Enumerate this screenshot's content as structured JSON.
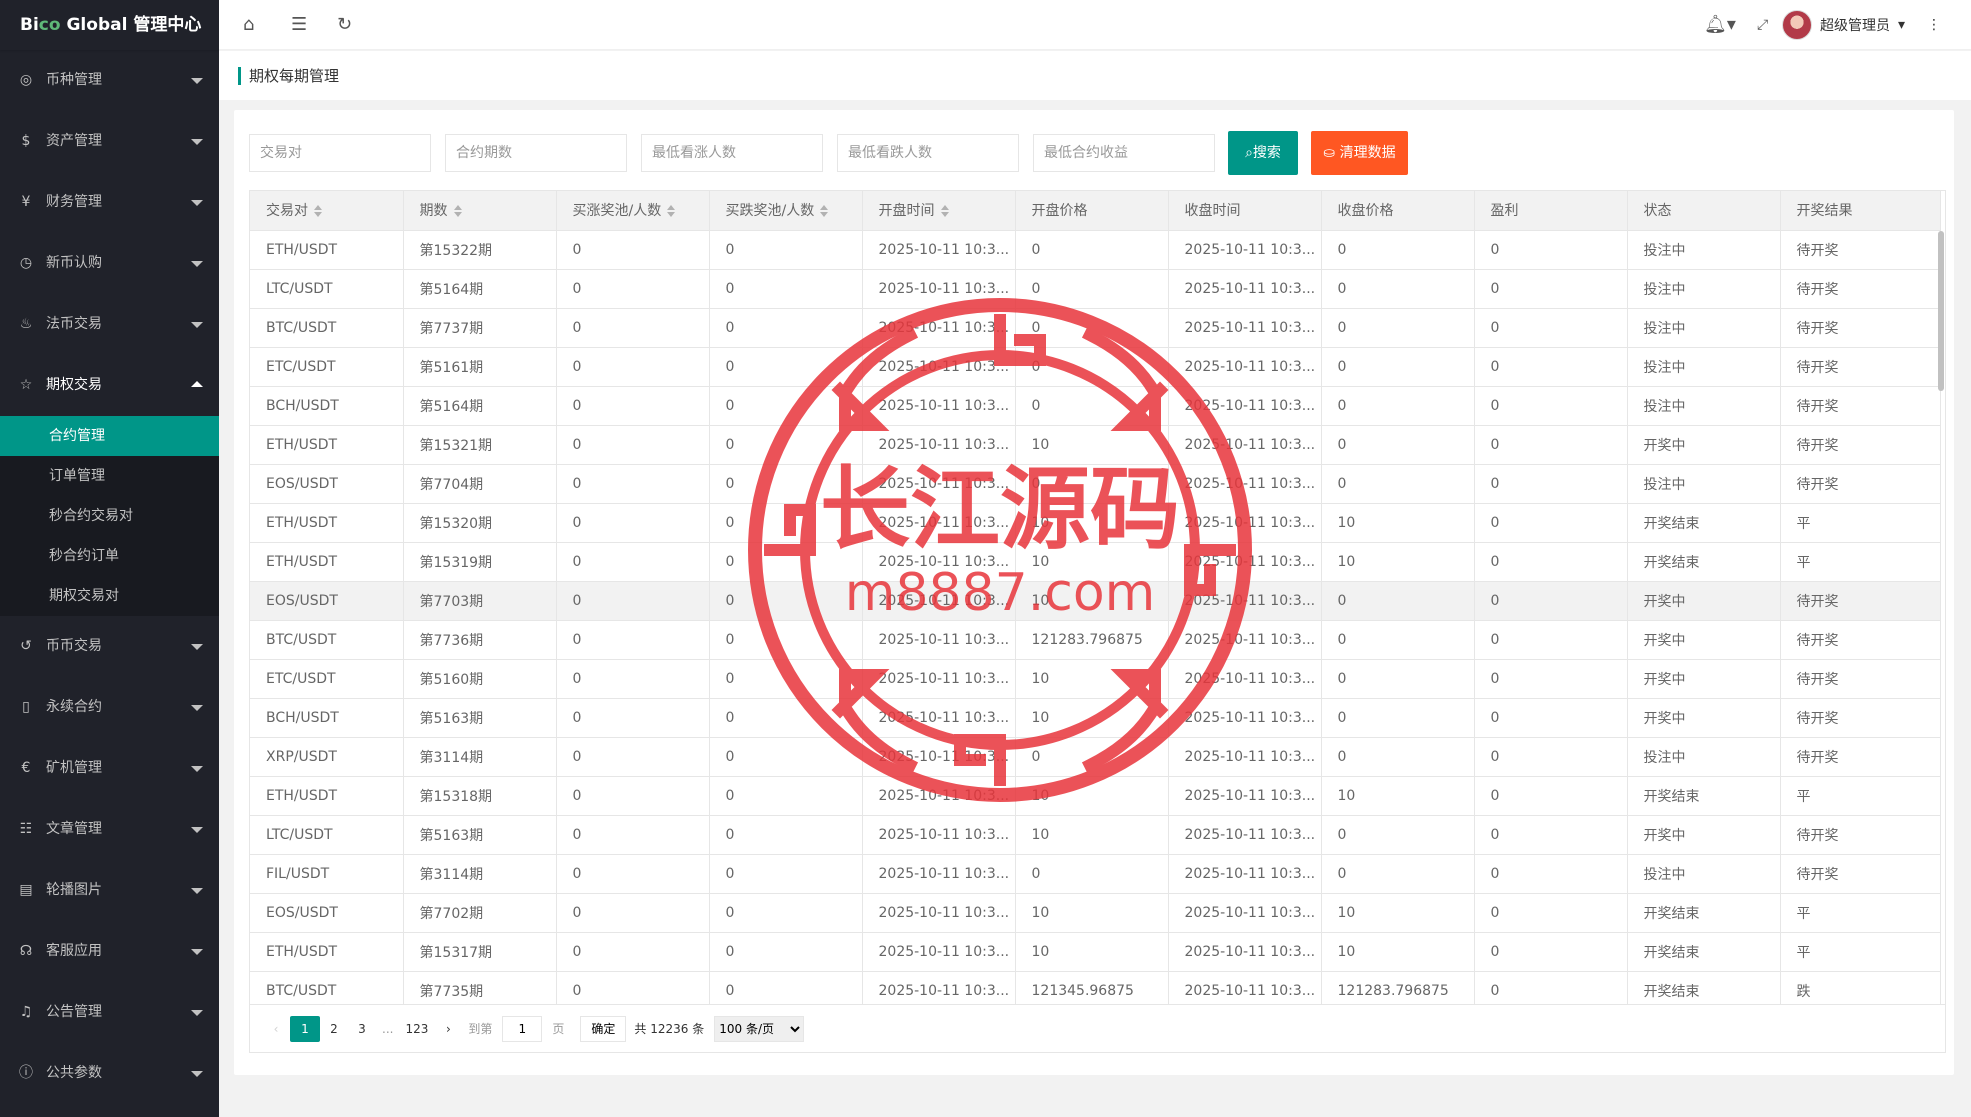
{
  "app": {
    "logo_prefix": "Bi",
    "logo_accent": "co",
    "logo_suffix": " Global 管理中心"
  },
  "sidebar": {
    "groups_before": [
      {
        "label": "币种管理",
        "icon": "coin-icon"
      },
      {
        "label": "资产管理",
        "icon": "dollar-icon"
      },
      {
        "label": "财务管理",
        "icon": "yen-icon"
      },
      {
        "label": "新币认购",
        "icon": "clock-icon"
      },
      {
        "label": "法币交易",
        "icon": "fire-icon"
      }
    ],
    "open_group": {
      "label": "期权交易",
      "icon": "star-icon"
    },
    "sub_items": [
      {
        "label": "合约管理",
        "active": true
      },
      {
        "label": "订单管理",
        "active": false
      },
      {
        "label": "秒合约交易对",
        "active": false
      },
      {
        "label": "秒合约订单",
        "active": false
      },
      {
        "label": "期权交易对",
        "active": false
      }
    ],
    "groups_after": [
      {
        "label": "币币交易",
        "icon": "refresh-icon"
      },
      {
        "label": "永续合约",
        "icon": "file-icon"
      },
      {
        "label": "矿机管理",
        "icon": "euro-icon"
      },
      {
        "label": "文章管理",
        "icon": "chat-icon"
      },
      {
        "label": "轮播图片",
        "icon": "image-icon"
      },
      {
        "label": "客服应用",
        "icon": "headset-icon"
      },
      {
        "label": "公告管理",
        "icon": "bell-icon"
      },
      {
        "label": "公共参数",
        "icon": "info-icon"
      }
    ]
  },
  "header": {
    "user_name": "超级管理员"
  },
  "page": {
    "title": "期权每期管理"
  },
  "filters": {
    "placeholders": [
      "交易对",
      "合约期数",
      "最低看涨人数",
      "最低看跌人数",
      "最低合约收益"
    ],
    "search_label": "搜索",
    "clear_label": "清理数据"
  },
  "table": {
    "columns": [
      {
        "label": "交易对",
        "sortable": true
      },
      {
        "label": "期数",
        "sortable": true
      },
      {
        "label": "买涨奖池/人数",
        "sortable": true
      },
      {
        "label": "买跌奖池/人数",
        "sortable": true
      },
      {
        "label": "开盘时间",
        "sortable": true
      },
      {
        "label": "开盘价格",
        "sortable": false
      },
      {
        "label": "收盘时间",
        "sortable": false
      },
      {
        "label": "收盘价格",
        "sortable": false
      },
      {
        "label": "盈利",
        "sortable": false
      },
      {
        "label": "状态",
        "sortable": false
      },
      {
        "label": "开奖结果",
        "sortable": false
      }
    ],
    "rows": [
      [
        "ETH/USDT",
        "第15322期",
        "0",
        "0",
        "2025-10-11 10:3...",
        "0",
        "2025-10-11 10:3...",
        "0",
        "0",
        "投注中",
        "待开奖"
      ],
      [
        "LTC/USDT",
        "第5164期",
        "0",
        "0",
        "2025-10-11 10:3...",
        "0",
        "2025-10-11 10:3...",
        "0",
        "0",
        "投注中",
        "待开奖"
      ],
      [
        "BTC/USDT",
        "第7737期",
        "0",
        "0",
        "2025-10-11 10:3...",
        "0",
        "2025-10-11 10:3...",
        "0",
        "0",
        "投注中",
        "待开奖"
      ],
      [
        "ETC/USDT",
        "第5161期",
        "0",
        "0",
        "2025-10-11 10:3...",
        "0",
        "2025-10-11 10:3...",
        "0",
        "0",
        "投注中",
        "待开奖"
      ],
      [
        "BCH/USDT",
        "第5164期",
        "0",
        "0",
        "2025-10-11 10:3...",
        "0",
        "2025-10-11 10:3...",
        "0",
        "0",
        "投注中",
        "待开奖"
      ],
      [
        "ETH/USDT",
        "第15321期",
        "0",
        "0",
        "2025-10-11 10:3...",
        "10",
        "2025-10-11 10:3...",
        "0",
        "0",
        "开奖中",
        "待开奖"
      ],
      [
        "EOS/USDT",
        "第7704期",
        "0",
        "0",
        "2025-10-11 10:3...",
        "0",
        "2025-10-11 10:3...",
        "0",
        "0",
        "投注中",
        "待开奖"
      ],
      [
        "ETH/USDT",
        "第15320期",
        "0",
        "0",
        "2025-10-11 10:3...",
        "10",
        "2025-10-11 10:3...",
        "10",
        "0",
        "开奖结束",
        "平"
      ],
      [
        "ETH/USDT",
        "第15319期",
        "0",
        "0",
        "2025-10-11 10:3...",
        "10",
        "2025-10-11 10:3...",
        "10",
        "0",
        "开奖结束",
        "平"
      ],
      [
        "EOS/USDT",
        "第7703期",
        "0",
        "0",
        "2025-10-11 10:3...",
        "10",
        "2025-10-11 10:3...",
        "0",
        "0",
        "开奖中",
        "待开奖"
      ],
      [
        "BTC/USDT",
        "第7736期",
        "0",
        "0",
        "2025-10-11 10:3...",
        "121283.796875",
        "2025-10-11 10:3...",
        "0",
        "0",
        "开奖中",
        "待开奖"
      ],
      [
        "ETC/USDT",
        "第5160期",
        "0",
        "0",
        "2025-10-11 10:3...",
        "10",
        "2025-10-11 10:3...",
        "0",
        "0",
        "开奖中",
        "待开奖"
      ],
      [
        "BCH/USDT",
        "第5163期",
        "0",
        "0",
        "2025-10-11 10:3...",
        "10",
        "2025-10-11 10:3...",
        "0",
        "0",
        "开奖中",
        "待开奖"
      ],
      [
        "XRP/USDT",
        "第3114期",
        "0",
        "0",
        "2025-10-11 10:3...",
        "0",
        "2025-10-11 10:3...",
        "0",
        "0",
        "投注中",
        "待开奖"
      ],
      [
        "ETH/USDT",
        "第15318期",
        "0",
        "0",
        "2025-10-11 10:3...",
        "10",
        "2025-10-11 10:3...",
        "10",
        "0",
        "开奖结束",
        "平"
      ],
      [
        "LTC/USDT",
        "第5163期",
        "0",
        "0",
        "2025-10-11 10:3...",
        "10",
        "2025-10-11 10:3...",
        "0",
        "0",
        "开奖中",
        "待开奖"
      ],
      [
        "FIL/USDT",
        "第3114期",
        "0",
        "0",
        "2025-10-11 10:3...",
        "0",
        "2025-10-11 10:3...",
        "0",
        "0",
        "投注中",
        "待开奖"
      ],
      [
        "EOS/USDT",
        "第7702期",
        "0",
        "0",
        "2025-10-11 10:3...",
        "10",
        "2025-10-11 10:3...",
        "10",
        "0",
        "开奖结束",
        "平"
      ],
      [
        "ETH/USDT",
        "第15317期",
        "0",
        "0",
        "2025-10-11 10:3...",
        "10",
        "2025-10-11 10:3...",
        "10",
        "0",
        "开奖结束",
        "平"
      ],
      [
        "BTC/USDT",
        "第7735期",
        "0",
        "0",
        "2025-10-11 10:3...",
        "121345.96875",
        "2025-10-11 10:3...",
        "121283.796875",
        "0",
        "开奖结束",
        "跌"
      ]
    ],
    "highlight_row": 9
  },
  "pager": {
    "pages": [
      "1",
      "2",
      "3"
    ],
    "ellipsis": "...",
    "last_page": "123",
    "goto_label": "到第",
    "goto_value": "1",
    "page_unit": "页",
    "confirm_label": "确定",
    "total_text": "共 12236 条",
    "page_size": "100 条/页"
  },
  "watermark": {
    "line1": "长江源码",
    "line2": "m8887.com",
    "color": "#e8353b"
  }
}
